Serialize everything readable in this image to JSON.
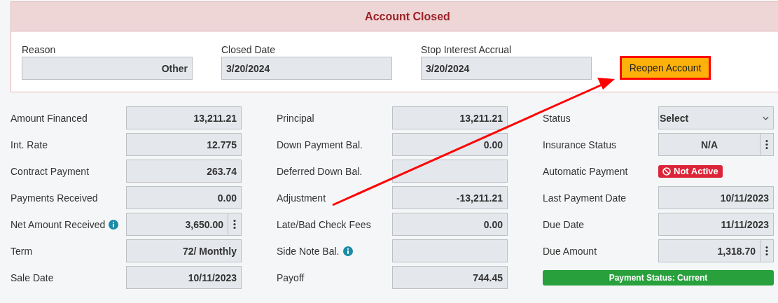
{
  "closed_panel": {
    "title": "Account Closed",
    "fields": [
      {
        "label": "Reason",
        "value": "Other",
        "kind": "choice"
      },
      {
        "label": "Closed Date",
        "value": "3/20/2024",
        "kind": "date"
      },
      {
        "label": "Stop Interest Accrual",
        "value": "3/20/2024",
        "kind": "date"
      }
    ],
    "reopen_button": {
      "label": "Reopen Account",
      "highlighted": true
    }
  },
  "columns": [
    [
      {
        "label": "Amount Financed",
        "kind": "field",
        "value": "13,211.21"
      },
      {
        "label": "Int. Rate",
        "kind": "field",
        "value": "12.775"
      },
      {
        "label": "Contract Payment",
        "kind": "field",
        "value": "263.74"
      },
      {
        "label": "Payments Received",
        "kind": "field",
        "value": "0.00"
      },
      {
        "label": "Net Amount Received",
        "kind": "menu-field",
        "value": "3,650.00",
        "info": true
      },
      {
        "label": "Term",
        "kind": "field",
        "value": "72/ Monthly"
      },
      {
        "label": "Sale Date",
        "kind": "field",
        "value": "10/11/2023"
      }
    ],
    [
      {
        "label": "Principal",
        "kind": "field",
        "value": "13,211.21"
      },
      {
        "label": "Down Payment Bal.",
        "kind": "field",
        "value": "0.00"
      },
      {
        "label": "Deferred Down Bal.",
        "kind": "field"
      },
      {
        "label": "Adjustment",
        "kind": "field",
        "value": "-13,211.21"
      },
      {
        "label": "Late/Bad Check Fees",
        "kind": "field",
        "value": "0.00"
      },
      {
        "label": "Side Note Bal.",
        "kind": "field",
        "info": true
      },
      {
        "label": "Payoff",
        "kind": "field",
        "value": "744.45"
      }
    ],
    [
      {
        "label": "Status",
        "kind": "select",
        "value": "Select"
      },
      {
        "label": "Insurance Status",
        "kind": "menu-choice",
        "value": "N/A"
      },
      {
        "label": "Automatic Payment",
        "kind": "badge",
        "value": "Not Active",
        "color": "#dc2438"
      },
      {
        "label": "Last Payment Date",
        "kind": "field",
        "value": "10/11/2023"
      },
      {
        "label": "Due Date",
        "kind": "field",
        "value": "11/11/2023"
      },
      {
        "label": "Due Amount",
        "kind": "menu-field",
        "value": "1,318.70"
      },
      {
        "kind": "status",
        "value": "Payment Status: Current",
        "color": "#28a03c"
      }
    ]
  ],
  "annotation": {
    "kind": "arrow"
  }
}
